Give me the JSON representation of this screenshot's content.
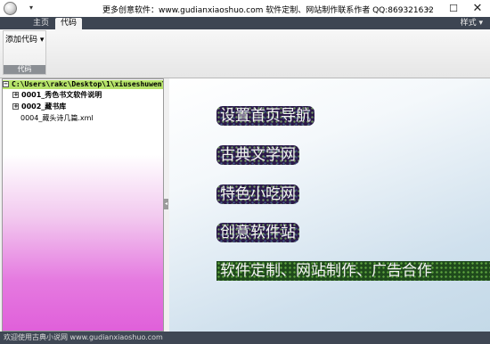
{
  "window": {
    "title": "更多创意软件：www.gudianxiaoshuo.com     软件定制、网站制作联系作者 QQ:869321632",
    "qat_arrow": "▾",
    "minimize": "–",
    "maximize": "☐",
    "close": "✕"
  },
  "ribbon": {
    "tabs": [
      {
        "label": "主页",
        "active": false
      },
      {
        "label": "代码",
        "active": true
      }
    ],
    "style_menu": "样式 ▾",
    "group": {
      "button_label": "添加代码 ▾",
      "label": "代码"
    }
  },
  "tree": {
    "root": "C:\\Users\\rakc\\Desktop\\1\\xiuseshuwen\\",
    "expander_symbol": "+",
    "items": [
      {
        "label": "0001_秀色书文软件说明",
        "type": "folder"
      },
      {
        "label": "0002_藏书库",
        "type": "folder"
      },
      {
        "label": "0004_藏头诗几篇.xml",
        "type": "file"
      }
    ]
  },
  "splitter": {
    "grip": "◂"
  },
  "links": [
    "设置首页导航",
    "古典文学网",
    "特色小吃网",
    "创意软件站",
    "软件定制、网站制作、广告合作"
  ],
  "status": {
    "text": "欢迎使用古典小说网 www.gudianxiaoshuo.com"
  },
  "colors": {
    "tree_root_highlight": "#b6e36a",
    "tree_gradient_bottom": "#e060da",
    "link_background": "#2b1a49",
    "status_bar": "#3f4754"
  }
}
